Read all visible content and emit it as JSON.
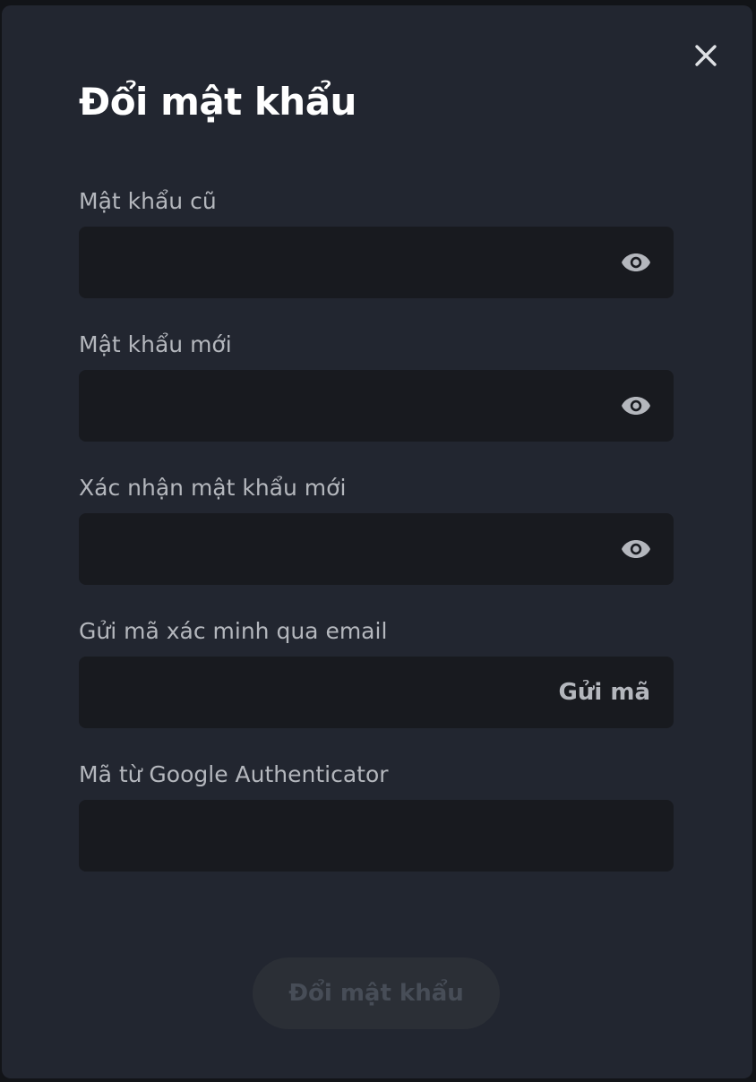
{
  "modal": {
    "title": "Đổi mật khẩu",
    "close_icon": "close-icon"
  },
  "fields": {
    "old_password": {
      "label": "Mật khẩu cũ",
      "value": "",
      "icon": "eye-icon"
    },
    "new_password": {
      "label": "Mật khẩu mới",
      "value": "",
      "icon": "eye-icon"
    },
    "confirm_password": {
      "label": "Xác nhận mật khẩu mới",
      "value": "",
      "icon": "eye-icon"
    },
    "email_code": {
      "label": "Gửi mã xác minh qua email",
      "value": "",
      "action_label": "Gửi mã"
    },
    "google_auth": {
      "label": "Mã từ Google Authenticator",
      "value": ""
    }
  },
  "submit": {
    "label": "Đổi mật khẩu",
    "enabled": false
  },
  "colors": {
    "modal_bg": "#222630",
    "input_bg": "#181a1f",
    "label": "#b4b7bd",
    "title": "#ffffff",
    "button_disabled_bg": "#2b2f36",
    "button_disabled_text": "#474d57"
  }
}
